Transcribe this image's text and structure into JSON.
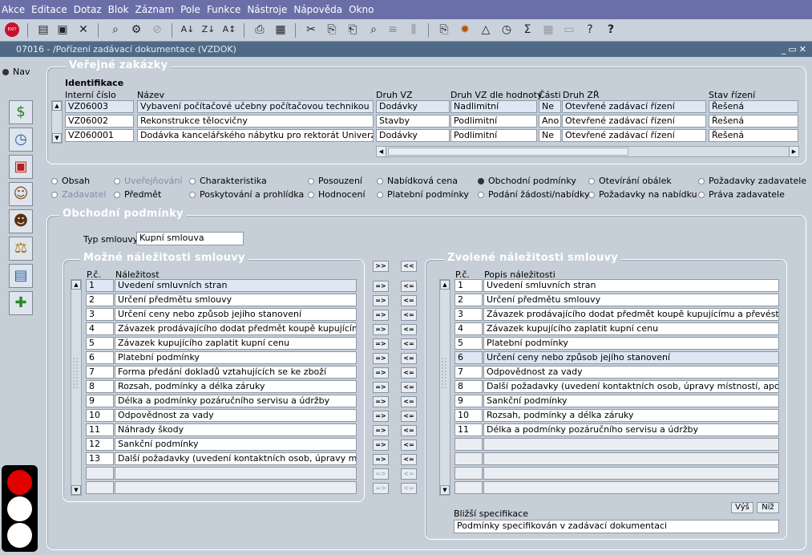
{
  "menu": [
    "Akce",
    "Editace",
    "Dotaz",
    "Blok",
    "Záznam",
    "Pole",
    "Funkce",
    "Nástroje",
    "Nápověda",
    "Okno"
  ],
  "window": {
    "title": "07016 - /Pořízení zadávací dokumentace (VZDOK)"
  },
  "nav": {
    "label": "Nav"
  },
  "verejne": {
    "legend": "Veřejné zakázky",
    "subheading": "Identifikace",
    "columns": [
      "Interní číslo",
      "Název",
      "Druh VZ",
      "Druh VZ dle hodnoty",
      "Části",
      "Druh ZŘ",
      "Stav řízení"
    ],
    "rows": [
      [
        "VZ06003",
        "Vybavení počítačové učebny počítačovou technikou",
        "Dodávky",
        "Nadlimitní",
        "Ne",
        "Otevřené zadávací řízení",
        "Řešená"
      ],
      [
        "VZ06002",
        "Rekonstrukce tělocvičny",
        "Stavby",
        "Podlimitní",
        "Ano",
        "Otevřené zadávací řízení",
        "Řešená"
      ],
      [
        "VZ060001",
        "Dodávka kancelářského nábytku pro rektorát Univerzity",
        "Dodávky",
        "Podlimitní",
        "Ne",
        "Otevřené zadávací řízení",
        "Řešená"
      ]
    ]
  },
  "tabs": [
    {
      "label": "Obsah",
      "state": "normal"
    },
    {
      "label": "Uveřejňování",
      "state": "disabled"
    },
    {
      "label": "Charakteristika",
      "state": "normal"
    },
    {
      "label": "Posouzení",
      "state": "normal"
    },
    {
      "label": "Nabídková cena",
      "state": "normal"
    },
    {
      "label": "Obchodní podmínky",
      "state": "selected"
    },
    {
      "label": "Otevírání obálek",
      "state": "normal"
    },
    {
      "label": "Požadavky zadavatele",
      "state": "normal"
    },
    {
      "label": "Zadavatel",
      "state": "disabled"
    },
    {
      "label": "Předmět",
      "state": "normal"
    },
    {
      "label": "Poskytování a prohlídka",
      "state": "normal"
    },
    {
      "label": "Hodnocení",
      "state": "normal"
    },
    {
      "label": "Platební podmínky",
      "state": "normal"
    },
    {
      "label": "Podání žádosti/nabídky",
      "state": "normal"
    },
    {
      "label": "Požadavky na nabídku",
      "state": "normal"
    },
    {
      "label": "Práva zadavatele",
      "state": "normal"
    }
  ],
  "obchodni": {
    "legend": "Obchodní podmínky",
    "typ_label": "Typ smlouvy",
    "typ_value": "Kupní smlouva"
  },
  "mozne": {
    "legend": "Možné náležitosti smlouvy",
    "col_pc": "P.č.",
    "col_name": "Náležitost",
    "rows": [
      [
        "1",
        "Uvedení smluvních stran"
      ],
      [
        "2",
        "Určení předmětu smlouvy"
      ],
      [
        "3",
        "Určení ceny nebo způsob jejího stanovení"
      ],
      [
        "4",
        "Závazek prodávajícího dodat předmět koupě kupujícímu a přev"
      ],
      [
        "5",
        "Závazek kupujícího zaplatit kupní cenu"
      ],
      [
        "6",
        "Platební podmínky"
      ],
      [
        "7",
        "Forma předání dokladů vztahujících se ke zboží"
      ],
      [
        "8",
        "Rozsah, podmínky a délka záruky"
      ],
      [
        "9",
        "Délka a podmínky pozáručního servisu a údržby"
      ],
      [
        "10",
        "Odpovědnost za vady"
      ],
      [
        "11",
        "Náhrady škody"
      ],
      [
        "12",
        "Sankční podmínky"
      ],
      [
        "13",
        "Další požadavky (uvedení kontaktních osob, úpravy místností,"
      ],
      [
        "",
        ""
      ],
      [
        "",
        ""
      ]
    ]
  },
  "transfer": {
    "all_right": ">>",
    "all_left": "<<",
    "right": "=>",
    "left": "<="
  },
  "zvolene": {
    "legend": "Zvolené náležitosti smlouvy",
    "col_pc": "P.č.",
    "col_name": "Popis náležitosti",
    "rows": [
      [
        "1",
        "Uvedení smluvních stran"
      ],
      [
        "2",
        "Určení předmětu smlouvy"
      ],
      [
        "3",
        "Závazek prodávajícího dodat předmět koupě kupujícímu a převést vlastnické"
      ],
      [
        "4",
        "Závazek kupujícího zaplatit kupní cenu"
      ],
      [
        "5",
        "Platební podmínky"
      ],
      [
        "6",
        "Určení ceny nebo způsob jejího stanovení"
      ],
      [
        "7",
        "Odpovědnost za vady"
      ],
      [
        "8",
        "Další požadavky (uvedení kontaktních osob, úpravy místností, apod.)"
      ],
      [
        "9",
        "Sankční podmínky"
      ],
      [
        "10",
        "Rozsah, podmínky a délka záruky"
      ],
      [
        "11",
        "Délka a podmínky pozáručního servisu a údržby"
      ],
      [
        "",
        ""
      ],
      [
        "",
        ""
      ],
      [
        "",
        ""
      ],
      [
        "",
        ""
      ]
    ],
    "btn_up": "Výš",
    "btn_down": "Níž",
    "spec_label": "Bližší specifikace",
    "spec_value": "Podmínky specifikován v zadávací dokumentaci"
  }
}
